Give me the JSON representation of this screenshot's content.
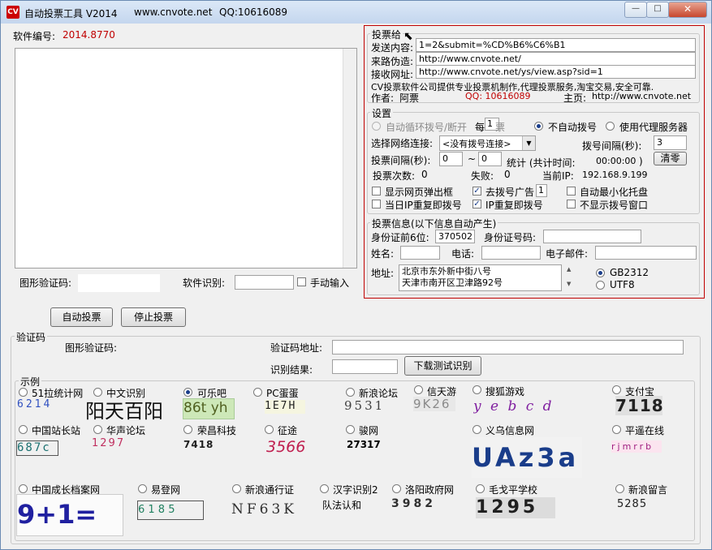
{
  "window": {
    "app_icon": "CV",
    "title": "自动投票工具 V2014",
    "site": "www.cnvote.net",
    "qq": "QQ:10616089",
    "min_label": "—",
    "max_label": "□",
    "close_label": "✕"
  },
  "software": {
    "id_label": "软件编号:",
    "id_value": "2014.8770"
  },
  "main": {
    "captcha_label": "图形验证码:",
    "software_recog_label": "软件识别:",
    "manual_input_label": "手动输入",
    "start_button": "自动投票",
    "stop_button": "停止投票"
  },
  "vote_to": {
    "legend": "投票给",
    "send_label": "发送内容:",
    "send_value": "1=2&submit=%CD%B6%C6%B1",
    "referer_label": "来路伪造:",
    "referer_value": "http://www.cnvote.net/",
    "receive_label": "接收网址:",
    "receive_value": "http://www.cnvote.net/ys/view.asp?sid=1",
    "promo": "CV投票软件公司提供专业投票机制作,代理投票服务,淘宝交易,安全可靠.",
    "author_label": "作者:",
    "author_value": "阿票",
    "qq_value": "QQ:  10616089",
    "homepage_label": "主页:",
    "homepage_value": "http://www.cnvote.net"
  },
  "settings": {
    "legend": "设置",
    "auto_dial_label": "自动循环拨号/断开",
    "every_label": "每",
    "every_value": "1",
    "every_suffix": "票",
    "no_dial_label": "不自动拨号",
    "use_proxy_label": "使用代理服务器",
    "select_conn_label": "选择网络连接:",
    "select_conn_value": "<没有拨号连接>",
    "dial_interval_label": "拨号间隔(秒):",
    "dial_interval_value": "3",
    "vote_interval_label": "投票间隔(秒):",
    "vote_interval_from": "0",
    "tilde": "~",
    "vote_interval_to": "0",
    "stats_label": "统计 (共计时间:",
    "stats_time": "00:00:00",
    "stats_close": ")",
    "clear_button": "清零",
    "vote_count_label": "投票次数:",
    "vote_count_value": "0",
    "fail_label": "失败:",
    "fail_value": "0",
    "current_ip_label": "当前IP:",
    "current_ip_value": "192.168.9.199",
    "popup_label": "显示网页弹出框",
    "dial_ad_label": "去拨号广告",
    "dial_ad_value": "1",
    "minimize_label": "自动最小化托盘",
    "same_day_ip_label": "当日IP重复即拨号",
    "ip_repeat_label": "IP重复即拨号",
    "hide_dial_label": "不显示拨号窗口"
  },
  "vote_info": {
    "legend": "投票信息(以下信息自动产生)",
    "id_prefix_label": "身份证前6位:",
    "id_prefix_value": "370502",
    "id_number_label": "身份证号码:",
    "name_label": "姓名:",
    "phone_label": "电话:",
    "email_label": "电子邮件:",
    "address_label": "地址:",
    "address_line1": "北京市东外新中街八号",
    "address_line2": "天津市南开区卫津路92号",
    "gb2312_label": "GB2312",
    "utf8_label": "UTF8"
  },
  "verify": {
    "legend": "验证码",
    "captcha_label": "图形验证码:",
    "address_label": "验证码地址:",
    "result_label": "识别结果:",
    "download_button": "下载测试识别"
  },
  "examples": {
    "legend": "示例",
    "items": [
      {
        "label": "51拉统计网",
        "captcha": "6214",
        "color": "#3050c0"
      },
      {
        "label": "中文识别",
        "captcha": "阳天百阳",
        "color": "#111111"
      },
      {
        "label": "可乐吧",
        "captcha": "86t yh",
        "color": "#506020"
      },
      {
        "label": "PC蛋蛋",
        "captcha": "1E7H",
        "color": "#202020"
      },
      {
        "label": "新浪论坛",
        "captcha": "9531",
        "color": "#404040"
      },
      {
        "label": "信天游",
        "captcha": "9K26",
        "color": "#8a8a8a"
      },
      {
        "label": "搜狐游戏",
        "captcha": "y e b c d",
        "color": "#8020a0"
      },
      {
        "label": "支付宝",
        "captcha": "7118",
        "color": "#222222"
      },
      {
        "label": "中国站长站",
        "captcha": "687c",
        "color": "#1a7070"
      },
      {
        "label": "华声论坛",
        "captcha": "1297",
        "color": "#c03060"
      },
      {
        "label": "荣昌科技",
        "captcha": "7418",
        "color": "#202020"
      },
      {
        "label": "征途",
        "captcha": "3566",
        "color": "#c02050"
      },
      {
        "label": "骏网",
        "captcha": "27317",
        "color": "#000000"
      },
      {
        "label": "义乌信息网",
        "captcha": "UAz3a",
        "color": "#1a3d8a"
      },
      {
        "label": "平遥在线",
        "captcha": "rjmrrb",
        "color": "#a02080"
      },
      {
        "label": "中国成长档案网",
        "captcha": "9+1=",
        "color": "#2020a0"
      },
      {
        "label": "易登网",
        "captcha": "6 1 8 5",
        "color": "#208060"
      },
      {
        "label": "新浪通行证",
        "captcha": "NF63K",
        "color": "#303030"
      },
      {
        "label": "汉字识别2",
        "captcha": "队法认和",
        "color": "#000000"
      },
      {
        "label": "洛阳政府网",
        "captcha": "3982",
        "color": "#303030"
      },
      {
        "label": "毛戈平学校",
        "captcha": "1295",
        "color": "#202020"
      },
      {
        "label": "新浪留言",
        "captcha": "5285",
        "color": "#202020"
      }
    ]
  },
  "colors": {
    "accent_red": "#c00000",
    "border_red": "#c00000"
  }
}
